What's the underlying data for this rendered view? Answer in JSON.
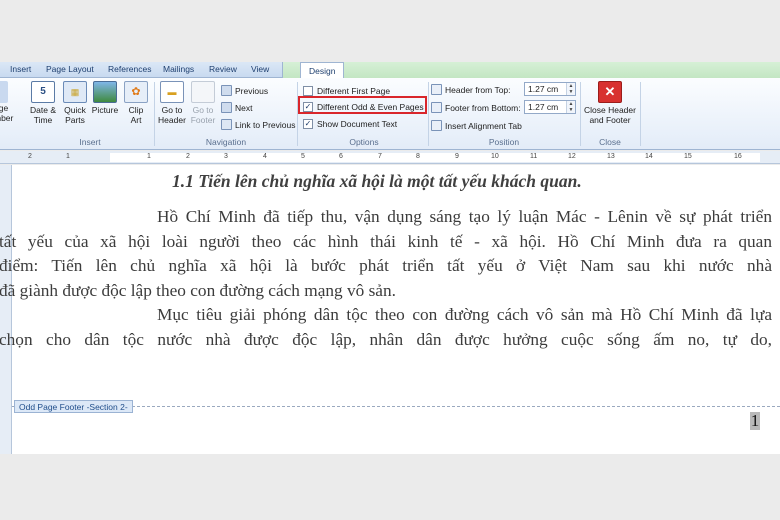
{
  "ribbon_tabs": [
    "Insert",
    "Page Layout",
    "References",
    "Mailings",
    "Review",
    "View",
    "Design"
  ],
  "insert_group": {
    "label": "Insert",
    "page_number_partial": [
      "age",
      "mber"
    ],
    "date_time": [
      "Date &",
      "Time"
    ],
    "quick_parts": [
      "Quick",
      "Parts"
    ],
    "picture": "Picture",
    "clip_art": [
      "Clip",
      "Art"
    ]
  },
  "navigation_group": {
    "label": "Navigation",
    "go_to_header": [
      "Go to",
      "Header"
    ],
    "go_to_footer": [
      "Go to",
      "Footer"
    ],
    "previous": "Previous",
    "next": "Next",
    "link_to_previous": "Link to Previous"
  },
  "options_group": {
    "label": "Options",
    "different_first_page": {
      "label": "Different First Page",
      "checked": false
    },
    "different_odd_even": {
      "label": "Different Odd & Even Pages",
      "checked": true
    },
    "show_document_text": {
      "label": "Show Document Text",
      "checked": true
    }
  },
  "position_group": {
    "label": "Position",
    "header_from_top": "Header from Top:",
    "header_from_top_value": "1.27 cm",
    "footer_from_bottom": "Footer from Bottom:",
    "footer_from_bottom_value": "1.27 cm",
    "insert_alignment_tab": "Insert Alignment Tab"
  },
  "close_group": {
    "label": "Close",
    "close_button": [
      "Close Header",
      "and Footer"
    ]
  },
  "ruler_numbers": [
    "2",
    "1",
    "1",
    "2",
    "3",
    "4",
    "5",
    "6",
    "7",
    "8",
    "9",
    "10",
    "11",
    "12",
    "13",
    "14",
    "15",
    "16"
  ],
  "document": {
    "heading": "1.1 Tiến lên chủ nghĩa xã hội là một tất yếu khách quan.",
    "paragraph1": [
      "Hồ Chí Minh đã tiếp thu, vận dụng sáng tạo lý luận Mác - Lênin về sự phát triển",
      "tất yếu của xã hội loài người theo các hình thái kinh tế - xã hội. Hồ Chí Minh đưa ra quan",
      "điểm: Tiến lên chủ nghĩa xã hội là bước phát triển tất yếu ở Việt Nam sau khi nước nhà",
      "đã giành được độc lập theo con đường cách mạng vô sản."
    ],
    "paragraph2": [
      "Mục tiêu giải phóng dân tộc theo con đường cách vô sản mà Hồ Chí Minh đã lựa",
      "chọn cho dân tộc nước nhà được độc lập, nhân dân được hưởng cuộc sống ấm no, tự do,"
    ],
    "footer_tag": "Odd Page Footer -Section 2-",
    "page_number": "1"
  },
  "colors": {
    "highlight_box": "#d9262b",
    "ribbon_bg": "#e3ecf8",
    "context_tab": "#c3e6c3"
  }
}
